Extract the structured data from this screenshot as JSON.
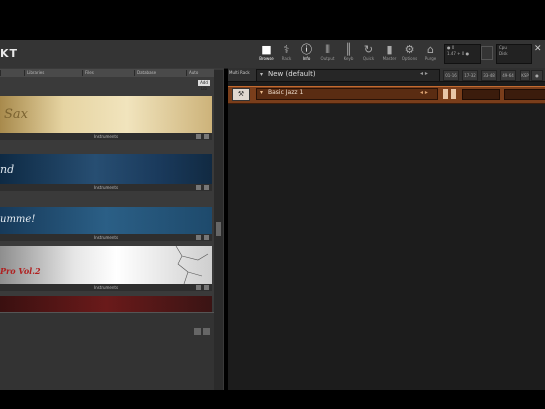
{
  "app": {
    "logo": "KT"
  },
  "toolbar": {
    "buttons": [
      {
        "name": "browse",
        "label": "Browse",
        "glyph": "■",
        "active": true
      },
      {
        "name": "rack",
        "label": "Rack",
        "glyph": "⚕",
        "active": false
      },
      {
        "name": "info",
        "label": "Info",
        "glyph": "ⓘ",
        "active": true
      },
      {
        "name": "output",
        "label": "Output",
        "glyph": "⫴",
        "active": false
      },
      {
        "name": "keyb",
        "label": "Keyb",
        "glyph": "║",
        "active": false
      },
      {
        "name": "quick",
        "label": "Quick",
        "glyph": "↻",
        "active": false
      },
      {
        "name": "mastr",
        "label": "Master",
        "glyph": "▮",
        "active": false
      },
      {
        "name": "options",
        "label": "Options",
        "glyph": "⚙",
        "active": false
      },
      {
        "name": "purge",
        "label": "Purge",
        "glyph": "⌂",
        "active": false
      }
    ],
    "cpu_line1": "● 0",
    "cpu_line2": "1.47 + 0 ●",
    "disk_label": "Cpu",
    "disk_label2": "Disk",
    "close": "✕"
  },
  "browser": {
    "tabs": [
      "",
      "Libraries",
      "Files",
      "Database",
      "Auto"
    ],
    "button": "Add Lib",
    "libraries": [
      {
        "script": "Sax",
        "footer": "Instruments"
      },
      {
        "script": "nd",
        "footer": "Instruments"
      },
      {
        "script": "umme!",
        "footer": "Instruments"
      },
      {
        "script": "Pro Vol.2",
        "footer": "Instruments"
      }
    ]
  },
  "rack": {
    "multi_label": "Multi Rack",
    "preset_arrow": "▾",
    "preset_name": "New (default)",
    "preset_nav": "◂ ▸",
    "hdr_buttons": [
      "01-16",
      "17-32",
      "33-48",
      "49-64",
      "KSP",
      "AUX",
      "●"
    ],
    "instrument": {
      "arrow": "▾",
      "name": "Basic Jazz 1",
      "nav": "◂ ▸",
      "wrench": "⚒"
    }
  },
  "colors": {
    "accent": "#c26a30",
    "instrument_bg": "#7a3e1b"
  }
}
